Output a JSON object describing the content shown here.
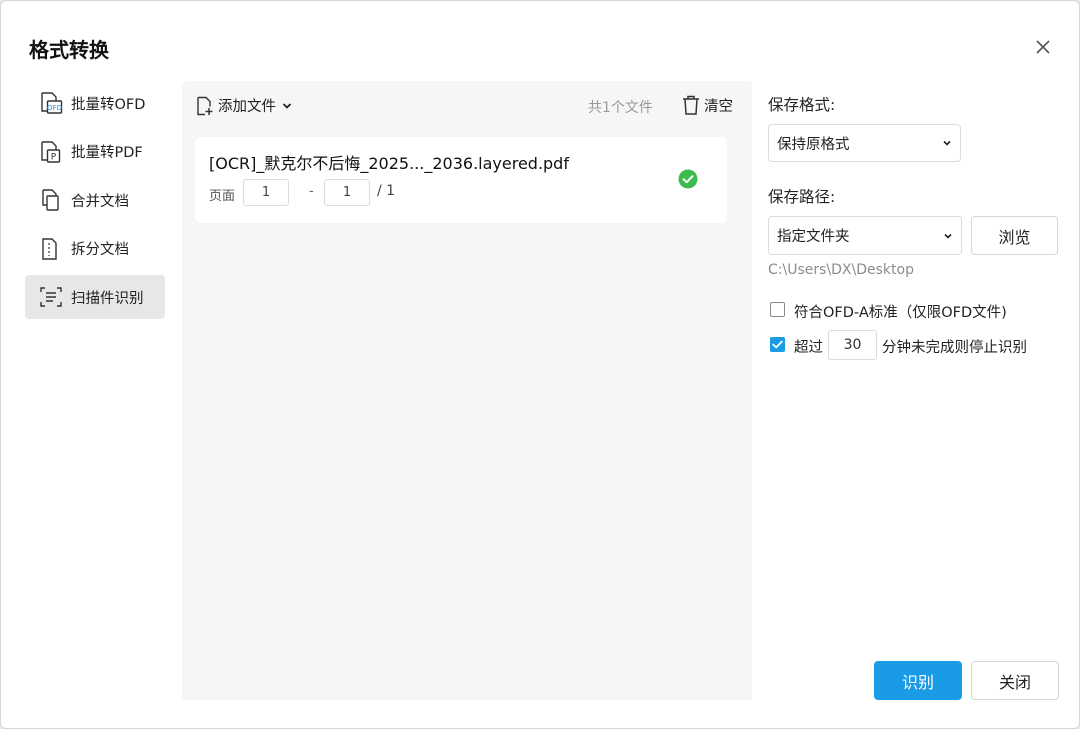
{
  "dialog": {
    "title": "格式转换"
  },
  "sidebar": {
    "items": [
      {
        "label": "批量转OFD",
        "icon": "ofd-convert-icon"
      },
      {
        "label": "批量转PDF",
        "icon": "pdf-convert-icon"
      },
      {
        "label": "合并文档",
        "icon": "merge-document-icon"
      },
      {
        "label": "拆分文档",
        "icon": "split-document-icon"
      },
      {
        "label": "扫描件识别",
        "icon": "scan-recognize-icon",
        "active": true
      }
    ]
  },
  "file_panel": {
    "add_file_label": "添加文件",
    "count_label": "共1个文件",
    "clear_label": "清空",
    "files": [
      {
        "name": "[OCR]_默克尔不后悔_2025..._2036.layered.pdf",
        "pages_label": "页面",
        "page_from": "1",
        "page_to": "1",
        "total": "/ 1",
        "status": "success"
      }
    ]
  },
  "settings": {
    "save_format_label": "保存格式:",
    "save_format_value": "保持原格式",
    "save_path_label": "保存路径:",
    "save_path_value": "指定文件夹",
    "browse_label": "浏览",
    "path_text": "C:\\Users\\DX\\Desktop",
    "ofd_a_label": "符合OFD-A标准（仅限OFD文件)",
    "ofd_a_checked": false,
    "timeout_prefix": "超过",
    "timeout_value": "30",
    "timeout_suffix": "分钟未完成则停止识别",
    "timeout_checked": true
  },
  "footer": {
    "recognize_label": "识别",
    "close_label": "关闭"
  },
  "colors": {
    "accent": "#1a9be6",
    "success": "#3dbb4e",
    "active_bg": "#e7e7e7",
    "panel_bg": "#f6f6f6"
  }
}
